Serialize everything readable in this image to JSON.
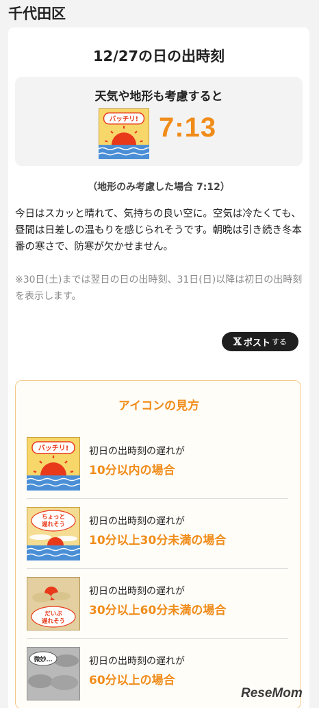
{
  "area": {
    "title": "千代田区"
  },
  "card": {
    "title": "12/27の日の出時刻",
    "forecast": {
      "label": "天気や地形も考慮すると",
      "icon_text": "バッチリ!",
      "time": "7:13"
    },
    "terrain_note": "（地形のみ考慮した場合 7:12）",
    "description": "今日はスカッと晴れて、気持ちの良い空に。空気は冷たくても、昼間は日差しの温もりを感じられそうです。朝晩は引き続き冬本番の寒さで、防寒が欠かせません。",
    "note": "※30日(土)までは翌日の日の出時刻、31日(日)以降は初日の出時刻を表示します。",
    "post_button": {
      "x": "𝕏",
      "label": "ポスト",
      "suffix": "する"
    }
  },
  "legend": {
    "title": "アイコンの見方",
    "items": [
      {
        "icon": "sunrise-clear-icon",
        "icon_text": "バッチリ!",
        "line1": "初日の出時刻の遅れが",
        "line2": "10分以内の場合"
      },
      {
        "icon": "sunrise-slightly-late-icon",
        "icon_text": "ちょっと遅れそう",
        "line1": "初日の出時刻の遅れが",
        "line2": "10分以上30分未満の場合"
      },
      {
        "icon": "sunrise-quite-late-icon",
        "icon_text": "だいぶ遅れそう",
        "line1": "初日の出時刻の遅れが",
        "line2": "30分以上60分未満の場合"
      },
      {
        "icon": "sunrise-doubtful-icon",
        "icon_text": "微妙…",
        "line1": "初日の出時刻の遅れが",
        "line2": "60分以上の場合"
      }
    ]
  },
  "brand": "ReseMom",
  "colors": {
    "accent": "#f08c1a",
    "sun": "#e8391b",
    "sea": "#4a8fd6"
  }
}
